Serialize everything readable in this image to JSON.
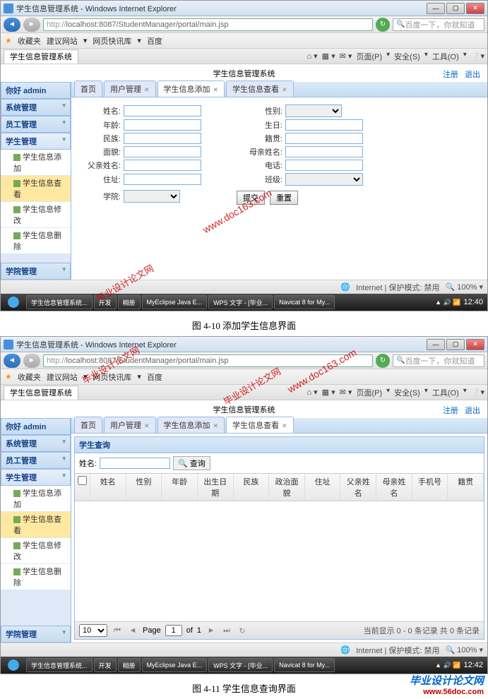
{
  "browser": {
    "window_title": "学生信息管理系统 - Windows Internet Explorer",
    "url_protocol": "http://",
    "url": "localhost:8087/StudentManager/portal/main.jsp",
    "search_placeholder": "百度一下，你就知道",
    "favorites_label": "收藏夹",
    "fav_links": [
      "建议网站",
      "网页快讯库",
      "百度"
    ],
    "tab_title": "学生信息管理系统",
    "tool_menu": [
      "页面(P)",
      "安全(S)",
      "工具(O)"
    ],
    "status_text": "Internet | 保护模式: 禁用",
    "zoom": "100%"
  },
  "app": {
    "title": "学生信息管理系统",
    "register": "注册",
    "logout": "退出",
    "greeting": "你好 admin",
    "sidebar": {
      "sys": "系统管理",
      "staff": "员工管理",
      "student": "学生管理",
      "college": "学院管理",
      "items": [
        "学生信息添加",
        "学生信息查看",
        "学生信息修改",
        "学生信息删除"
      ]
    },
    "tabs": {
      "home": "首页",
      "user": "用户管理",
      "add": "学生信息添加",
      "view": "学生信息查看"
    }
  },
  "form": {
    "name": "姓名:",
    "gender": "性别:",
    "age": "年龄:",
    "birth": "生日:",
    "nation": "民族:",
    "native": "籍贯:",
    "face": "面貌:",
    "mother": "母亲姓名:",
    "father": "父亲姓名:",
    "phone": "电话:",
    "addr": "住址:",
    "class": "班级:",
    "college": "学院:",
    "submit": "提交",
    "reset": "重置"
  },
  "query": {
    "panel_title": "学生查询",
    "name_label": "姓名:",
    "search_btn": "查询",
    "columns": [
      "",
      "姓名",
      "性别",
      "年龄",
      "出生日期",
      "民族",
      "政治面貌",
      "住址",
      "父亲姓名",
      "母亲姓名",
      "手机号",
      "籍贯"
    ],
    "page_size": "10",
    "page_label_pre": "Page",
    "page_current": "1",
    "page_label_mid": "of",
    "page_total": "1",
    "info": "当前显示 0 - 0 条记录 共 0 条记录"
  },
  "taskbar": {
    "items1": [
      "学生信息管理系统...",
      "开发",
      "相册",
      "MyEclipse Java E...",
      "WPS 文字 - [毕业...",
      "Navicat 8 for My..."
    ],
    "time1": "12:40",
    "items2": [
      "学生信息管理系统...",
      "开发",
      "相册",
      "MyEclipse Java E...",
      "WPS 文字 - [毕业...",
      "Navicat 8 for My..."
    ],
    "time2": "12:42"
  },
  "captions": {
    "c1": "图 4-10 添加学生信息界面",
    "c2": "图 4-11 学生信息查询界面"
  },
  "watermarks": {
    "url": "www.doc163.com",
    "text": "毕业设计论文网",
    "footer_url": "www.56doc.com"
  }
}
